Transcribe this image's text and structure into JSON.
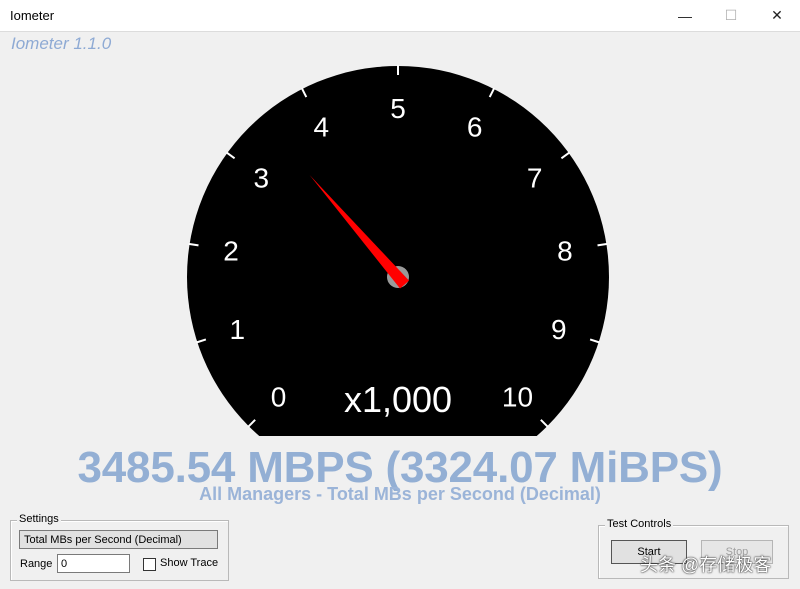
{
  "window": {
    "title": "Iometer",
    "minimize_glyph": "—",
    "maximize_glyph": "☐",
    "close_glyph": "✕"
  },
  "app": {
    "version_label": "Iometer 1.1.0"
  },
  "gauge": {
    "scale_labels": [
      "0",
      "1",
      "2",
      "3",
      "4",
      "5",
      "6",
      "7",
      "8",
      "9",
      "10"
    ],
    "scale_min": 0,
    "scale_max": 10,
    "multiplier_label": "x1,000",
    "needle_value": 3.48554,
    "needle_color": "#ff0000",
    "face_color": "#000000"
  },
  "readout": {
    "rate_text": "3485.54 MBPS (3324.07 MiBPS)",
    "subtitle": "All Managers - Total MBs per Second (Decimal)",
    "color": "#93afd4"
  },
  "settings": {
    "group_label": "Settings",
    "metric_button": "Total MBs per Second (Decimal)",
    "range_label": "Range",
    "range_value": "0",
    "show_trace_label": "Show Trace",
    "show_trace_checked": false
  },
  "test_controls": {
    "group_label": "Test Controls",
    "start_label": "Start",
    "stop_label": "Stop"
  },
  "watermark": {
    "text": "头条 @存储极客"
  }
}
